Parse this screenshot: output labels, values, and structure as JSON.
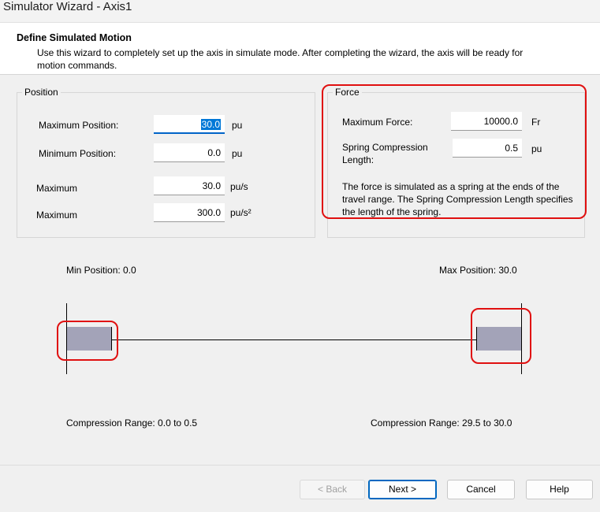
{
  "window": {
    "title": "Simulator Wizard - Axis1"
  },
  "header": {
    "title": "Define Simulated Motion",
    "description": "Use this wizard to completely set up the axis in simulate mode. After completing the wizard, the axis will be ready for motion commands."
  },
  "position_group": {
    "legend": "Position",
    "max_position": {
      "label": "Maximum Position:",
      "value": "30.0",
      "unit": "pu"
    },
    "min_position": {
      "label": "Minimum Position:",
      "value": "0.0",
      "unit": "pu"
    },
    "max_velocity": {
      "label": "Maximum",
      "value": "30.0",
      "unit": "pu/s"
    },
    "max_accel": {
      "label": "Maximum",
      "value": "300.0",
      "unit": "pu/s²"
    }
  },
  "force_group": {
    "legend": "Force",
    "max_force": {
      "label": "Maximum Force:",
      "value": "10000.0",
      "unit": "Fr"
    },
    "spring_length": {
      "label": "Spring Compression Length:",
      "value": "0.5",
      "unit": "pu"
    },
    "note": "The force is simulated as a spring at the ends of the travel range. The Spring Compression Length specifies the length of the spring."
  },
  "diagram": {
    "min_label": "Min Position: 0.0",
    "max_label": "Max Position: 30.0",
    "left_range": "Compression Range: 0.0 to 0.5",
    "right_range": "Compression Range: 29.5 to 30.0",
    "spring_color": "#a3a3b8"
  },
  "buttons": {
    "back": "< Back",
    "next": "Next >",
    "cancel": "Cancel",
    "help": "Help"
  },
  "colors": {
    "highlight": "#e01010",
    "selection": "#0078d7"
  }
}
